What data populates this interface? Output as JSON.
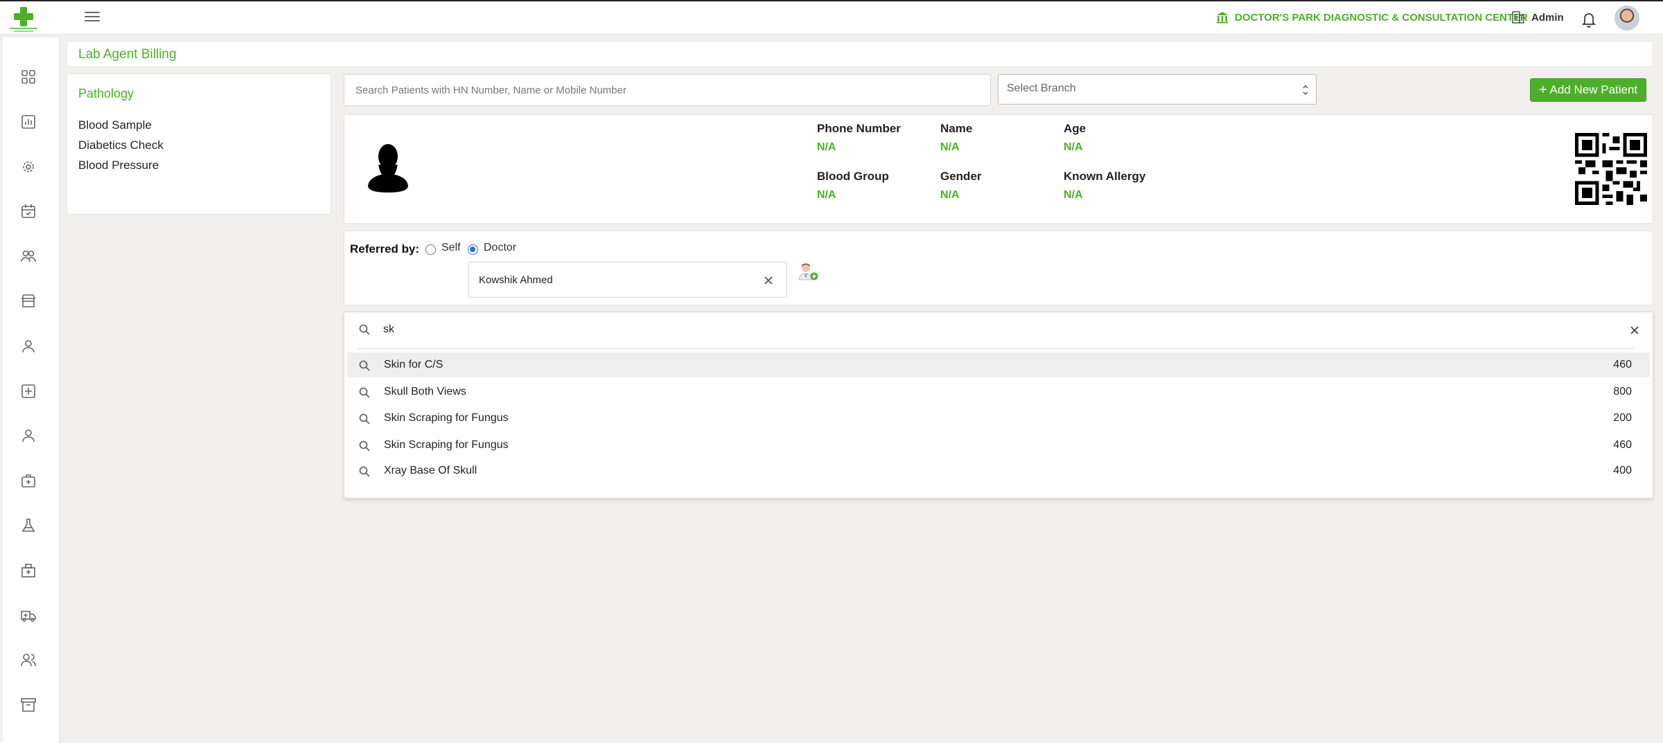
{
  "header": {
    "org_name": "DOCTOR'S PARK DIAGNOSTIC & CONSULTATION CENTER",
    "user_name": "Admin"
  },
  "page": {
    "title": "Lab Agent Billing"
  },
  "categories": {
    "title": "Pathology",
    "items": [
      "Blood Sample",
      "Diabetics Check",
      "Blood Pressure"
    ]
  },
  "patient_search": {
    "placeholder": "Search Patients with HN Number, Name or Mobile Number",
    "value": ""
  },
  "branch_select": {
    "placeholder": "Select Branch"
  },
  "add_patient": {
    "label": "Add New Patient"
  },
  "patient": {
    "phone_label": "Phone Number",
    "phone_value": "N/A",
    "name_label": "Name",
    "name_value": "N/A",
    "age_label": "Age",
    "age_value": "N/A",
    "blood_label": "Blood Group",
    "blood_value": "N/A",
    "gender_label": "Gender",
    "gender_value": "N/A",
    "allergy_label": "Known Allergy",
    "allergy_value": "N/A"
  },
  "referral": {
    "label": "Referred by:",
    "self_label": "Self",
    "doctor_label": "Doctor",
    "selected": "Doctor",
    "doctor_value": "Kowshik Ahmed"
  },
  "test_search": {
    "query": "sk",
    "results": [
      {
        "name": "Skin for C/S",
        "price": "460"
      },
      {
        "name": "Skull Both Views",
        "price": "800"
      },
      {
        "name": "Skin Scraping for Fungus",
        "price": "200"
      },
      {
        "name": "Skin Scraping for Fungus",
        "price": "460"
      },
      {
        "name": "Xray Base Of Skull",
        "price": "400"
      }
    ]
  },
  "colors": {
    "accent": "#4caf2a",
    "radio": "#2a6fd6"
  },
  "sidebar_icons": [
    "dashboard-icon",
    "chart-icon",
    "settings-icon",
    "calendar-check-icon",
    "users-group-icon",
    "store-icon",
    "user-icon",
    "hospital-plus-icon",
    "user-icon",
    "medical-case-icon",
    "flask-icon",
    "hospital-icon",
    "ambulance-icon",
    "team-icon",
    "archive-icon"
  ]
}
